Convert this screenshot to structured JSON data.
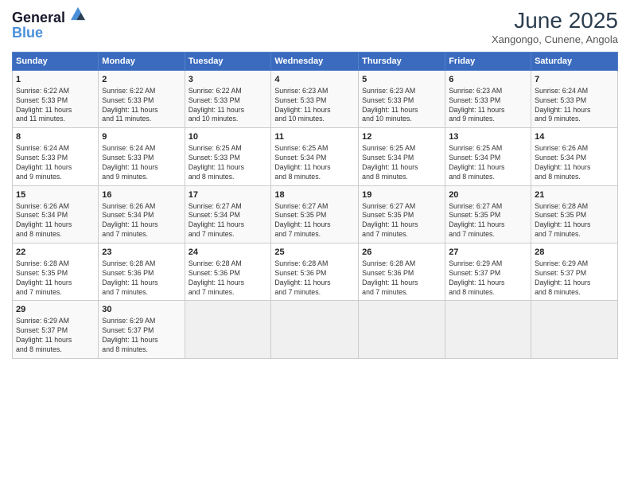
{
  "header": {
    "logo_line1": "General",
    "logo_line2": "Blue",
    "month": "June 2025",
    "location": "Xangongo, Cunene, Angola"
  },
  "weekdays": [
    "Sunday",
    "Monday",
    "Tuesday",
    "Wednesday",
    "Thursday",
    "Friday",
    "Saturday"
  ],
  "weeks": [
    [
      {
        "day": "1",
        "lines": [
          "Sunrise: 6:22 AM",
          "Sunset: 5:33 PM",
          "Daylight: 11 hours",
          "and 11 minutes."
        ]
      },
      {
        "day": "2",
        "lines": [
          "Sunrise: 6:22 AM",
          "Sunset: 5:33 PM",
          "Daylight: 11 hours",
          "and 11 minutes."
        ]
      },
      {
        "day": "3",
        "lines": [
          "Sunrise: 6:22 AM",
          "Sunset: 5:33 PM",
          "Daylight: 11 hours",
          "and 10 minutes."
        ]
      },
      {
        "day": "4",
        "lines": [
          "Sunrise: 6:23 AM",
          "Sunset: 5:33 PM",
          "Daylight: 11 hours",
          "and 10 minutes."
        ]
      },
      {
        "day": "5",
        "lines": [
          "Sunrise: 6:23 AM",
          "Sunset: 5:33 PM",
          "Daylight: 11 hours",
          "and 10 minutes."
        ]
      },
      {
        "day": "6",
        "lines": [
          "Sunrise: 6:23 AM",
          "Sunset: 5:33 PM",
          "Daylight: 11 hours",
          "and 9 minutes."
        ]
      },
      {
        "day": "7",
        "lines": [
          "Sunrise: 6:24 AM",
          "Sunset: 5:33 PM",
          "Daylight: 11 hours",
          "and 9 minutes."
        ]
      }
    ],
    [
      {
        "day": "8",
        "lines": [
          "Sunrise: 6:24 AM",
          "Sunset: 5:33 PM",
          "Daylight: 11 hours",
          "and 9 minutes."
        ]
      },
      {
        "day": "9",
        "lines": [
          "Sunrise: 6:24 AM",
          "Sunset: 5:33 PM",
          "Daylight: 11 hours",
          "and 9 minutes."
        ]
      },
      {
        "day": "10",
        "lines": [
          "Sunrise: 6:25 AM",
          "Sunset: 5:33 PM",
          "Daylight: 11 hours",
          "and 8 minutes."
        ]
      },
      {
        "day": "11",
        "lines": [
          "Sunrise: 6:25 AM",
          "Sunset: 5:34 PM",
          "Daylight: 11 hours",
          "and 8 minutes."
        ]
      },
      {
        "day": "12",
        "lines": [
          "Sunrise: 6:25 AM",
          "Sunset: 5:34 PM",
          "Daylight: 11 hours",
          "and 8 minutes."
        ]
      },
      {
        "day": "13",
        "lines": [
          "Sunrise: 6:25 AM",
          "Sunset: 5:34 PM",
          "Daylight: 11 hours",
          "and 8 minutes."
        ]
      },
      {
        "day": "14",
        "lines": [
          "Sunrise: 6:26 AM",
          "Sunset: 5:34 PM",
          "Daylight: 11 hours",
          "and 8 minutes."
        ]
      }
    ],
    [
      {
        "day": "15",
        "lines": [
          "Sunrise: 6:26 AM",
          "Sunset: 5:34 PM",
          "Daylight: 11 hours",
          "and 8 minutes."
        ]
      },
      {
        "day": "16",
        "lines": [
          "Sunrise: 6:26 AM",
          "Sunset: 5:34 PM",
          "Daylight: 11 hours",
          "and 7 minutes."
        ]
      },
      {
        "day": "17",
        "lines": [
          "Sunrise: 6:27 AM",
          "Sunset: 5:34 PM",
          "Daylight: 11 hours",
          "and 7 minutes."
        ]
      },
      {
        "day": "18",
        "lines": [
          "Sunrise: 6:27 AM",
          "Sunset: 5:35 PM",
          "Daylight: 11 hours",
          "and 7 minutes."
        ]
      },
      {
        "day": "19",
        "lines": [
          "Sunrise: 6:27 AM",
          "Sunset: 5:35 PM",
          "Daylight: 11 hours",
          "and 7 minutes."
        ]
      },
      {
        "day": "20",
        "lines": [
          "Sunrise: 6:27 AM",
          "Sunset: 5:35 PM",
          "Daylight: 11 hours",
          "and 7 minutes."
        ]
      },
      {
        "day": "21",
        "lines": [
          "Sunrise: 6:28 AM",
          "Sunset: 5:35 PM",
          "Daylight: 11 hours",
          "and 7 minutes."
        ]
      }
    ],
    [
      {
        "day": "22",
        "lines": [
          "Sunrise: 6:28 AM",
          "Sunset: 5:35 PM",
          "Daylight: 11 hours",
          "and 7 minutes."
        ]
      },
      {
        "day": "23",
        "lines": [
          "Sunrise: 6:28 AM",
          "Sunset: 5:36 PM",
          "Daylight: 11 hours",
          "and 7 minutes."
        ]
      },
      {
        "day": "24",
        "lines": [
          "Sunrise: 6:28 AM",
          "Sunset: 5:36 PM",
          "Daylight: 11 hours",
          "and 7 minutes."
        ]
      },
      {
        "day": "25",
        "lines": [
          "Sunrise: 6:28 AM",
          "Sunset: 5:36 PM",
          "Daylight: 11 hours",
          "and 7 minutes."
        ]
      },
      {
        "day": "26",
        "lines": [
          "Sunrise: 6:28 AM",
          "Sunset: 5:36 PM",
          "Daylight: 11 hours",
          "and 7 minutes."
        ]
      },
      {
        "day": "27",
        "lines": [
          "Sunrise: 6:29 AM",
          "Sunset: 5:37 PM",
          "Daylight: 11 hours",
          "and 8 minutes."
        ]
      },
      {
        "day": "28",
        "lines": [
          "Sunrise: 6:29 AM",
          "Sunset: 5:37 PM",
          "Daylight: 11 hours",
          "and 8 minutes."
        ]
      }
    ],
    [
      {
        "day": "29",
        "lines": [
          "Sunrise: 6:29 AM",
          "Sunset: 5:37 PM",
          "Daylight: 11 hours",
          "and 8 minutes."
        ]
      },
      {
        "day": "30",
        "lines": [
          "Sunrise: 6:29 AM",
          "Sunset: 5:37 PM",
          "Daylight: 11 hours",
          "and 8 minutes."
        ]
      },
      {
        "day": "",
        "lines": []
      },
      {
        "day": "",
        "lines": []
      },
      {
        "day": "",
        "lines": []
      },
      {
        "day": "",
        "lines": []
      },
      {
        "day": "",
        "lines": []
      }
    ]
  ]
}
